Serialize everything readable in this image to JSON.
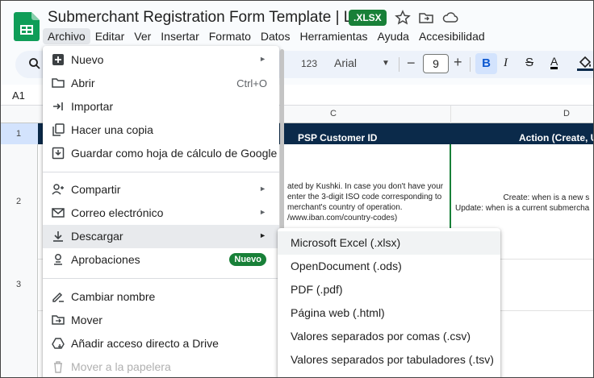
{
  "header": {
    "title": "Submerchant Registration Form Template | Latam",
    "badge": ".XLSX"
  },
  "menubar": [
    "Archivo",
    "Editar",
    "Ver",
    "Insertar",
    "Formato",
    "Datos",
    "Herramientas",
    "Ayuda",
    "Accesibilidad"
  ],
  "toolbar": {
    "number_format": "123",
    "font": "Arial",
    "font_size": "9",
    "minus": "−",
    "plus": "+",
    "bold": "B",
    "italic": "I",
    "strike": "S",
    "text_color": "A"
  },
  "formula_bar": {
    "cell_ref": "A1"
  },
  "grid": {
    "columns": [
      "C",
      "D"
    ],
    "rows": [
      "1",
      "2",
      "3"
    ],
    "row1": {
      "c": "PSP Customer ID",
      "d": "Action (Create, U"
    },
    "row2_c": [
      "ated by Kushki. In case you don't have your",
      "enter the 3-digit ISO code corresponding to",
      "merchant's country of operation.",
      "/www.iban.com/country-codes)"
    ],
    "row2_d": [
      "Create: when is a new s",
      "Update: when is a current submercha"
    ]
  },
  "file_menu": {
    "items": [
      {
        "label": "Nuevo",
        "icon": "plus-sheet-icon",
        "arrow": true
      },
      {
        "label": "Abrir",
        "icon": "folder-icon",
        "shortcut": "Ctrl+O"
      },
      {
        "label": "Importar",
        "icon": "import-arrow-icon"
      },
      {
        "label": "Hacer una copia",
        "icon": "copy-icon"
      },
      {
        "label": "Guardar como hoja de cálculo de Google",
        "icon": "save-sheet-icon"
      },
      {
        "label": "Compartir",
        "icon": "share-person-icon",
        "arrow": true
      },
      {
        "label": "Correo electrónico",
        "icon": "mail-icon",
        "arrow": true
      },
      {
        "label": "Descargar",
        "icon": "download-icon",
        "arrow": true
      },
      {
        "label": "Aprobaciones",
        "icon": "approvals-icon",
        "badge": "Nuevo"
      },
      {
        "label": "Cambiar nombre",
        "icon": "rename-icon"
      },
      {
        "label": "Mover",
        "icon": "move-folder-icon"
      },
      {
        "label": "Añadir acceso directo a Drive",
        "icon": "drive-shortcut-icon"
      },
      {
        "label": "Mover a la papelera",
        "icon": "trash-icon"
      }
    ]
  },
  "download_menu": {
    "items": [
      "Microsoft Excel (.xlsx)",
      "OpenDocument (.ods)",
      "PDF (.pdf)",
      "Página web (.html)",
      "Valores separados por comas (.csv)",
      "Valores separados por tabuladores (.tsv)"
    ]
  },
  "colors": {
    "accent_green": "#188038",
    "header_row_bg": "#0b2a4a",
    "toolbar_bg": "#edf2fa",
    "hover_bg": "#e8eaed"
  }
}
